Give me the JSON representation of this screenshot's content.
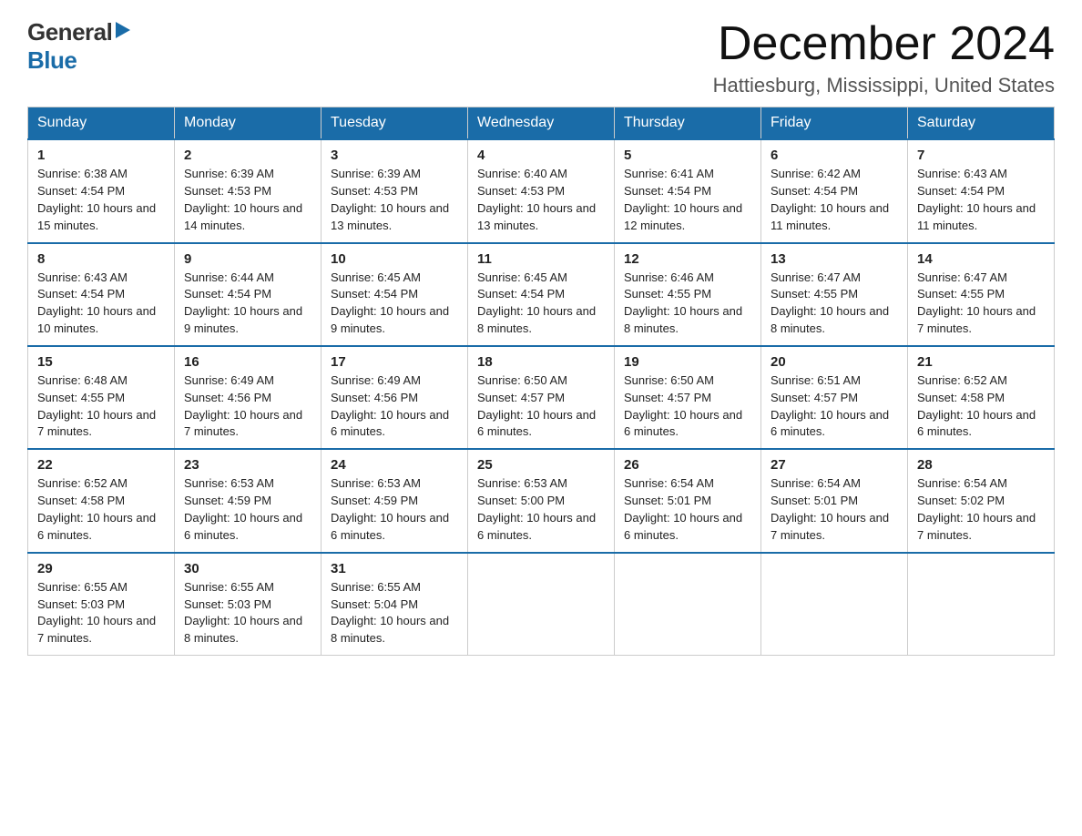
{
  "header": {
    "title": "December 2024",
    "subtitle": "Hattiesburg, Mississippi, United States"
  },
  "logo": {
    "general": "General",
    "blue": "Blue"
  },
  "weekdays": [
    "Sunday",
    "Monday",
    "Tuesday",
    "Wednesday",
    "Thursday",
    "Friday",
    "Saturday"
  ],
  "weeks": [
    [
      {
        "day": "1",
        "sunrise": "6:38 AM",
        "sunset": "4:54 PM",
        "daylight": "10 hours and 15 minutes."
      },
      {
        "day": "2",
        "sunrise": "6:39 AM",
        "sunset": "4:53 PM",
        "daylight": "10 hours and 14 minutes."
      },
      {
        "day": "3",
        "sunrise": "6:39 AM",
        "sunset": "4:53 PM",
        "daylight": "10 hours and 13 minutes."
      },
      {
        "day": "4",
        "sunrise": "6:40 AM",
        "sunset": "4:53 PM",
        "daylight": "10 hours and 13 minutes."
      },
      {
        "day": "5",
        "sunrise": "6:41 AM",
        "sunset": "4:54 PM",
        "daylight": "10 hours and 12 minutes."
      },
      {
        "day": "6",
        "sunrise": "6:42 AM",
        "sunset": "4:54 PM",
        "daylight": "10 hours and 11 minutes."
      },
      {
        "day": "7",
        "sunrise": "6:43 AM",
        "sunset": "4:54 PM",
        "daylight": "10 hours and 11 minutes."
      }
    ],
    [
      {
        "day": "8",
        "sunrise": "6:43 AM",
        "sunset": "4:54 PM",
        "daylight": "10 hours and 10 minutes."
      },
      {
        "day": "9",
        "sunrise": "6:44 AM",
        "sunset": "4:54 PM",
        "daylight": "10 hours and 9 minutes."
      },
      {
        "day": "10",
        "sunrise": "6:45 AM",
        "sunset": "4:54 PM",
        "daylight": "10 hours and 9 minutes."
      },
      {
        "day": "11",
        "sunrise": "6:45 AM",
        "sunset": "4:54 PM",
        "daylight": "10 hours and 8 minutes."
      },
      {
        "day": "12",
        "sunrise": "6:46 AM",
        "sunset": "4:55 PM",
        "daylight": "10 hours and 8 minutes."
      },
      {
        "day": "13",
        "sunrise": "6:47 AM",
        "sunset": "4:55 PM",
        "daylight": "10 hours and 8 minutes."
      },
      {
        "day": "14",
        "sunrise": "6:47 AM",
        "sunset": "4:55 PM",
        "daylight": "10 hours and 7 minutes."
      }
    ],
    [
      {
        "day": "15",
        "sunrise": "6:48 AM",
        "sunset": "4:55 PM",
        "daylight": "10 hours and 7 minutes."
      },
      {
        "day": "16",
        "sunrise": "6:49 AM",
        "sunset": "4:56 PM",
        "daylight": "10 hours and 7 minutes."
      },
      {
        "day": "17",
        "sunrise": "6:49 AM",
        "sunset": "4:56 PM",
        "daylight": "10 hours and 6 minutes."
      },
      {
        "day": "18",
        "sunrise": "6:50 AM",
        "sunset": "4:57 PM",
        "daylight": "10 hours and 6 minutes."
      },
      {
        "day": "19",
        "sunrise": "6:50 AM",
        "sunset": "4:57 PM",
        "daylight": "10 hours and 6 minutes."
      },
      {
        "day": "20",
        "sunrise": "6:51 AM",
        "sunset": "4:57 PM",
        "daylight": "10 hours and 6 minutes."
      },
      {
        "day": "21",
        "sunrise": "6:52 AM",
        "sunset": "4:58 PM",
        "daylight": "10 hours and 6 minutes."
      }
    ],
    [
      {
        "day": "22",
        "sunrise": "6:52 AM",
        "sunset": "4:58 PM",
        "daylight": "10 hours and 6 minutes."
      },
      {
        "day": "23",
        "sunrise": "6:53 AM",
        "sunset": "4:59 PM",
        "daylight": "10 hours and 6 minutes."
      },
      {
        "day": "24",
        "sunrise": "6:53 AM",
        "sunset": "4:59 PM",
        "daylight": "10 hours and 6 minutes."
      },
      {
        "day": "25",
        "sunrise": "6:53 AM",
        "sunset": "5:00 PM",
        "daylight": "10 hours and 6 minutes."
      },
      {
        "day": "26",
        "sunrise": "6:54 AM",
        "sunset": "5:01 PM",
        "daylight": "10 hours and 6 minutes."
      },
      {
        "day": "27",
        "sunrise": "6:54 AM",
        "sunset": "5:01 PM",
        "daylight": "10 hours and 7 minutes."
      },
      {
        "day": "28",
        "sunrise": "6:54 AM",
        "sunset": "5:02 PM",
        "daylight": "10 hours and 7 minutes."
      }
    ],
    [
      {
        "day": "29",
        "sunrise": "6:55 AM",
        "sunset": "5:03 PM",
        "daylight": "10 hours and 7 minutes."
      },
      {
        "day": "30",
        "sunrise": "6:55 AM",
        "sunset": "5:03 PM",
        "daylight": "10 hours and 8 minutes."
      },
      {
        "day": "31",
        "sunrise": "6:55 AM",
        "sunset": "5:04 PM",
        "daylight": "10 hours and 8 minutes."
      },
      null,
      null,
      null,
      null
    ]
  ]
}
